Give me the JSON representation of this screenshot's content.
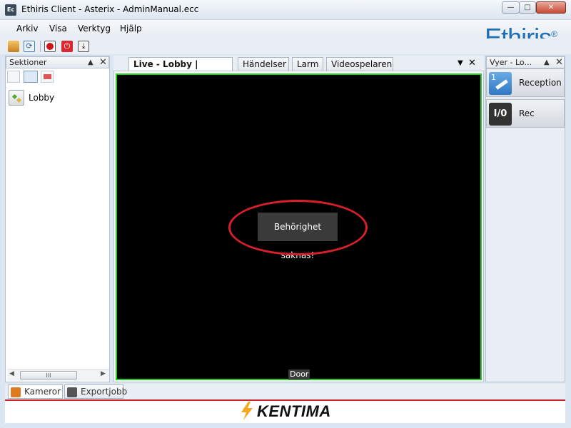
{
  "window": {
    "title": "Ethiris Client - Asterix - AdminManual.ecc",
    "app_icon_text": "Ec"
  },
  "menu": {
    "items": [
      "Arkiv",
      "Visa",
      "Verktyg",
      "Hjälp"
    ]
  },
  "logo": "Ethiris",
  "logo_mark": "®",
  "left_panel": {
    "title": "Sektioner",
    "tree": [
      {
        "label": "Lobby"
      }
    ],
    "scroll_glyph": "III"
  },
  "tabs": [
    {
      "label": "Live - Lobby | Reception",
      "active": true
    },
    {
      "label": "Händelser",
      "active": false
    },
    {
      "label": "Larm",
      "active": false
    },
    {
      "label": "Videospelaren",
      "active": false
    }
  ],
  "video": {
    "message": "Behörighet saknas!",
    "camera_label": "Door",
    "border_color": "#1fd11f"
  },
  "right_panel": {
    "title": "Vyer - Lo...",
    "views": [
      {
        "label": "Reception",
        "icon_text": "1"
      },
      {
        "label": "Rec",
        "icon_text": "I/0"
      }
    ]
  },
  "bottom_tabs": [
    "Kameror",
    "Exportjobb"
  ],
  "footer": {
    "brand": "KENTIMA"
  },
  "colors": {
    "accent": "#1f6fb6",
    "alert_ring": "#d5202a",
    "footer_line": "#c9232b"
  }
}
